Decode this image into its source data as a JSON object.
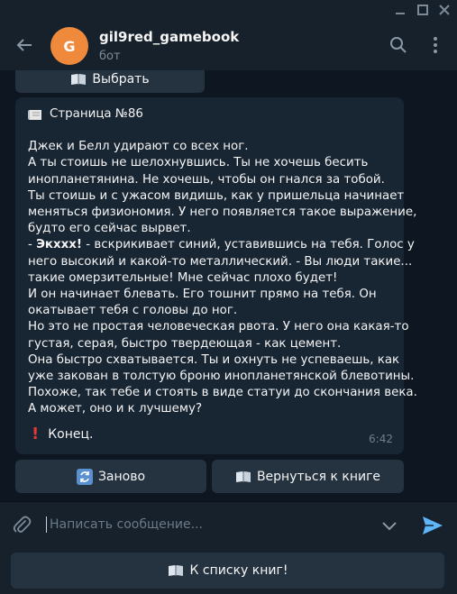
{
  "header": {
    "avatar_letter": "G",
    "title": "gil9red_gamebook",
    "subtitle": "бот",
    "icons": [
      "back-arrow-icon",
      "search-icon",
      "more-vertical-icon"
    ]
  },
  "keyboard_top": {
    "label": "Выбрать",
    "icon": "book-icon"
  },
  "message": {
    "page_label": "Страница №86",
    "page_icon": "page-icon",
    "lines": [
      "Джек и Белл удирают со всех ног.",
      "А ты стоишь не шелохнувшись. Ты не хочешь бесить",
      "инопланетянина. Не хочешь, чтобы он гнался за тобой.",
      "Ты стоишь и с ужасом видишь, как у пришельца начинает",
      "меняться физиономия. У него появляется такое выражение,",
      "будто его сейчас вырвет."
    ],
    "shout_dash": "- ",
    "shout": "Экхxx!",
    "lines_after_shout_first": " - вскрикивает синий, уставившись на тебя. Голос у",
    "lines2": [
      "него высокий и какой-то металлический. - Вы люди такие...",
      "такие омерзительные! Мне сейчас плохо будет!",
      "И он начинает блевать. Его тошнит прямо на тебя. Он",
      "окатывает тебя с головы до ног.",
      "Но это не простая человеческая рвота. У него она какая-то",
      "густая, серая, быстро твердеющая - как цемент.",
      "Она быстро схватывается. Ты и охнуть не успеваешь, как",
      "уже закован в толстую броню инопланетянской блевотины.",
      "Похоже, так тебе и стоять в виде статуи до скончания века.",
      "А может, оно и к лучшему?"
    ],
    "end_label": "Конец.",
    "end_icon": "exclamation-icon",
    "time": "6:42"
  },
  "inline_keyboard": {
    "again_label": "Заново",
    "again_icon": "refresh-icon",
    "return_label": "Вернуться к книге",
    "return_icon": "book-icon"
  },
  "composer": {
    "placeholder": "Написать сообщение...",
    "value": ""
  },
  "reply_keyboard": {
    "label": "К списку книг!",
    "icon": "book-icon"
  },
  "colors": {
    "background": "#0e1621",
    "panel": "#17212b",
    "bubble": "#182533",
    "button": "#253341",
    "accent": "#5eb5f7",
    "avatar": "#ef8a3c"
  }
}
